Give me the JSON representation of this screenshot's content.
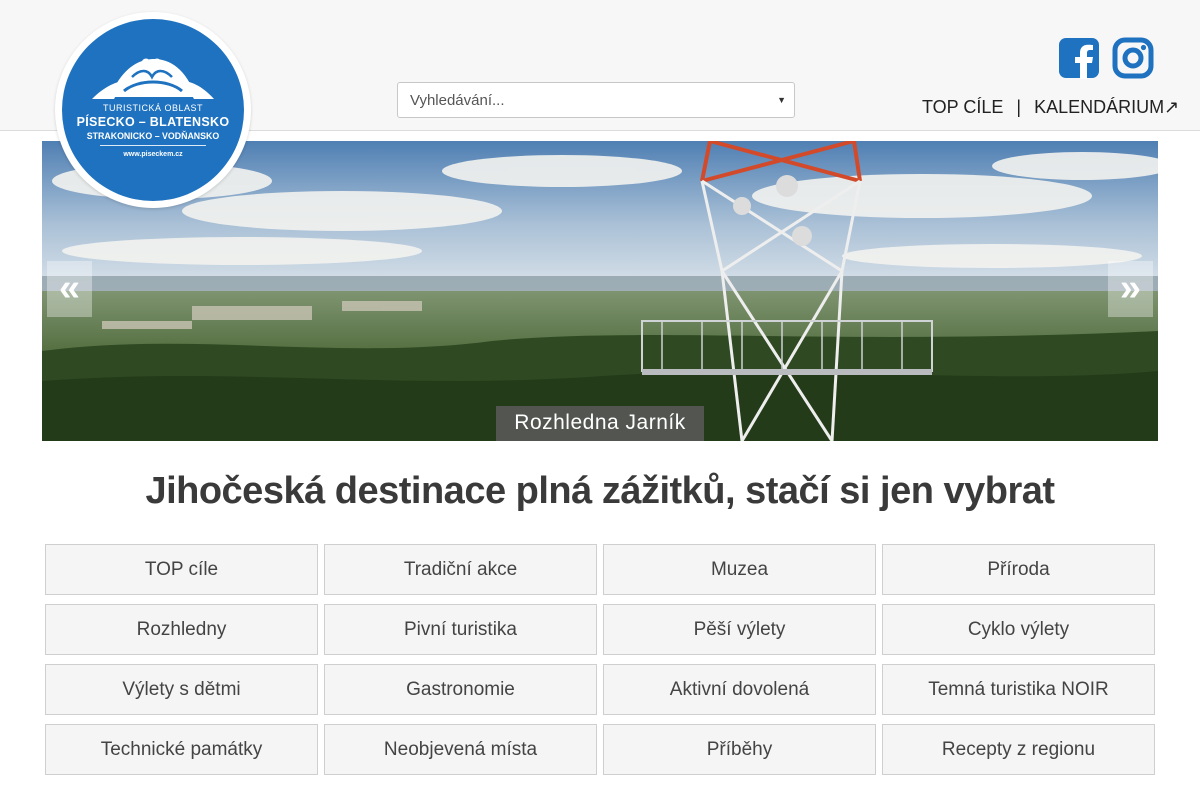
{
  "logo": {
    "line1": "TURISTICKÁ OBLAST",
    "line2": "PÍSECKO – BLATENSKO",
    "line3": "STRAKONICKO – VODŇANSKO",
    "line4": "www.piseckem.cz"
  },
  "search": {
    "text": "Vyhledávání..."
  },
  "social": {
    "facebook_icon": "facebook-icon",
    "instagram_icon": "instagram-icon"
  },
  "topnav": {
    "top_cile": "TOP CÍLE",
    "separator": "|",
    "kalendarium": "KALENDÁRIUM↗"
  },
  "slider": {
    "prev": "«",
    "next": "»",
    "caption": "Rozhledna Jarník"
  },
  "headline": "Jihočeská destinace plná zážitků, stačí si jen vybrat",
  "categories": [
    "TOP cíle",
    "Tradiční akce",
    "Muzea",
    "Příroda",
    "Rozhledny",
    "Pivní turistika",
    "Pěší výlety",
    "Cyklo výlety",
    "Výlety s dětmi",
    "Gastronomie",
    "Aktivní dovolená",
    "Temná turistika NOIR",
    "Technické památky",
    "Neobjevená místa",
    "Příběhy",
    "Recepty z regionu"
  ],
  "colors": {
    "brand_blue": "#1e72bf",
    "social_blue": "#1e72bf"
  }
}
